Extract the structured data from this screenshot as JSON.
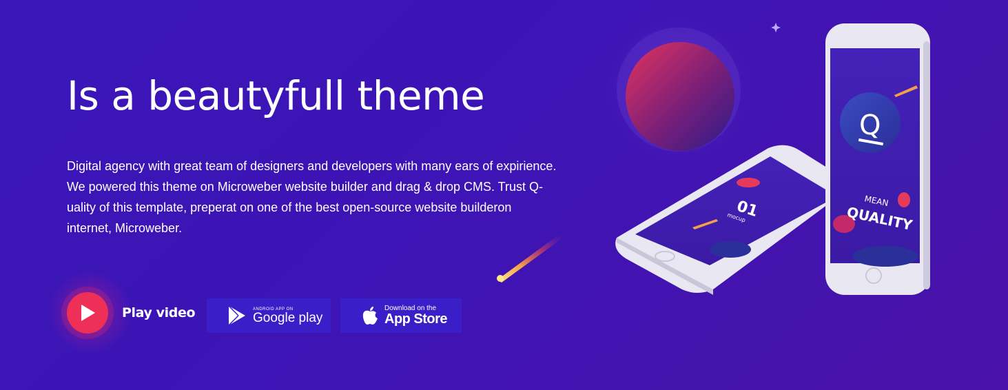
{
  "hero": {
    "title": "Is a beautyfull theme",
    "description_lines": [
      "Digital agency with great team of designers and developers with many ears of expirience.",
      "We powered this theme on Microweber website builder and drag & drop CMS. Trust Q-",
      "uality of this template, preperat on one of the best open-source website builderon",
      "internet, Microweber."
    ]
  },
  "cta": {
    "play_label": "Play video",
    "google_play": {
      "small": "Android app on",
      "big": "Google play"
    },
    "app_store": {
      "small": "Download on the",
      "big": "App Store"
    }
  },
  "illustration": {
    "phone_back": {
      "small": "MEAN",
      "big": "QUALITY",
      "logo_letter": "Q"
    },
    "phone_front": {
      "number": "01",
      "caption": "mocup"
    }
  },
  "colors": {
    "background": "#3d14b6",
    "accent_red": "#ee2f57",
    "store_button": "#3a1fc9"
  }
}
